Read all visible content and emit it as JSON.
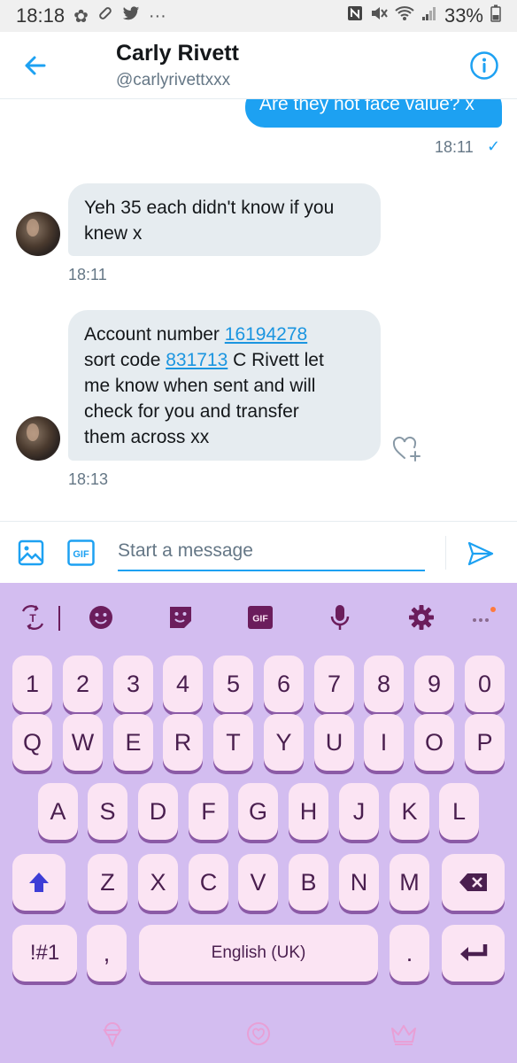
{
  "status_bar": {
    "time": "18:18",
    "dots": "···",
    "battery": "33%",
    "icons": [
      "flower-icon",
      "pill-icon",
      "twitter-icon",
      "nfc-icon",
      "mute-icon",
      "wifi-icon",
      "signal-icon",
      "battery-icon"
    ]
  },
  "header": {
    "title": "Carly Rivett",
    "handle": "@carlyrivettxxx"
  },
  "messages": [
    {
      "direction": "out",
      "text": "Are they not face value? x",
      "time": "18:11"
    },
    {
      "direction": "in",
      "line1": "Yeh 35 each didn't know if you",
      "line2": "knew x",
      "time": "18:11"
    },
    {
      "direction": "in",
      "account_label": "Account number ",
      "account_number": "16194278",
      "sort_label": "sort code ",
      "sort_code": "831713",
      "sort_rest": " C Rivett let",
      "line3": "me know when sent and will",
      "line4": "check for you and transfer",
      "line5": "them across xx",
      "time": "18:13"
    }
  ],
  "composer": {
    "placeholder": "Start a message",
    "gif_label": "GIF"
  },
  "keyboard": {
    "toolbar_gif": "GIF",
    "number_row": [
      "1",
      "2",
      "3",
      "4",
      "5",
      "6",
      "7",
      "8",
      "9",
      "0"
    ],
    "row_q": [
      "Q",
      "W",
      "E",
      "R",
      "T",
      "Y",
      "U",
      "I",
      "O",
      "P"
    ],
    "row_a": [
      "A",
      "S",
      "D",
      "F",
      "G",
      "H",
      "J",
      "K",
      "L"
    ],
    "row_z": [
      "Z",
      "X",
      "C",
      "V",
      "B",
      "N",
      "M"
    ],
    "symbols_label": "!#1",
    "comma": ",",
    "space_label": "English (UK)",
    "period": "."
  },
  "colors": {
    "accent": "#1da1f2",
    "keyboard_bg": "#d3bdf0",
    "key_bg": "#fbe4f3",
    "key_text": "#4a1f4f",
    "toolbar_icon": "#6b1d5c"
  }
}
